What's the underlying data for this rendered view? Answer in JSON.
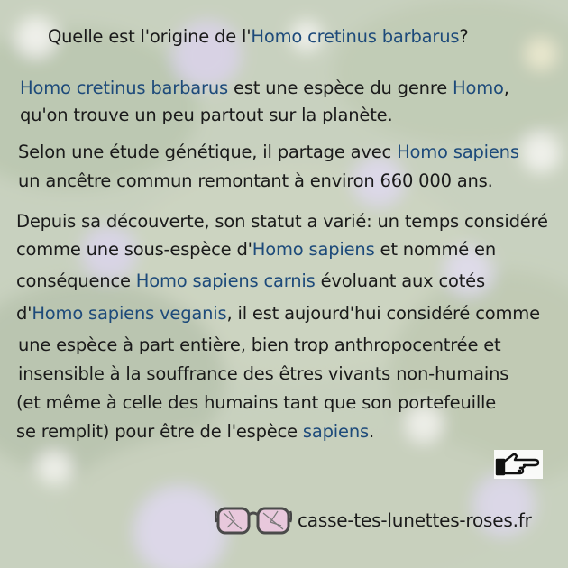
{
  "title": {
    "before": "Quelle est l'origine de l'",
    "highlight": "Homo cretinus barbarus",
    "after": "?"
  },
  "paragraph1": {
    "line1": {
      "t1": "Homo cretinus barbarus",
      "t2": " est une espèce du genre ",
      "t3": "Homo",
      "t4": ","
    },
    "line2": {
      "t1": "qu'on trouve un peu partout sur la planète."
    }
  },
  "paragraph2": {
    "line1": {
      "t1": "Selon une étude génétique, il partage avec ",
      "t2": "Homo sapiens"
    },
    "line2": {
      "t1": "un ancêtre commun remontant à environ 660 000  ans."
    }
  },
  "paragraph3": {
    "line1": {
      "t1": "Depuis sa découverte, son statut a varié: un temps considéré"
    },
    "line2": {
      "t1": "comme une sous-espèce d'",
      "t2": "Homo sapiens",
      "t3": " et nommé en"
    },
    "line3": {
      "t1": "conséquence  ",
      "t2": "Homo sapiens carnis",
      "t3": " évoluant aux cotés"
    },
    "line4": {
      "t1": "d'",
      "t2": "Homo sapiens veganis",
      "t3": ", il est aujourd'hui considéré comme"
    },
    "line5": {
      "t1": "une espèce à part entière, bien trop anthropocentrée et"
    },
    "line6": {
      "t1": "insensible à la souffrance des êtres vivants non-humains"
    },
    "line7": {
      "t1": "(et même à celle des humains tant que son portefeuille"
    },
    "line8": {
      "t1": " se remplit) pour être de l'espèce ",
      "t2": "sapiens",
      "t3": "."
    }
  },
  "footer": {
    "site": "casse-tes-lunettes-roses.fr",
    "logo_icon": "pink-glasses-icon",
    "next_icon": "pointing-hand-icon"
  },
  "colors": {
    "text": "#1a1a1a",
    "highlight": "#1d4a7a",
    "veil": "#eceee6"
  }
}
